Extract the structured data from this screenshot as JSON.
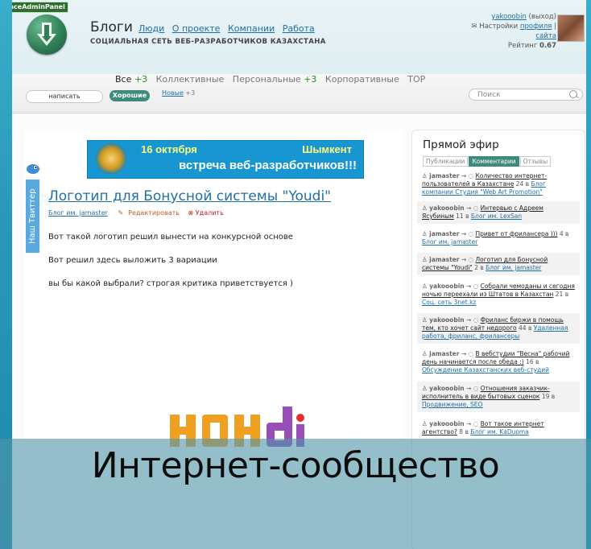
{
  "admin_badge": "PaceAdminPanel",
  "site": {
    "title": "Блоги",
    "nav": [
      "Люди",
      "О проекте",
      "Компании",
      "Работа"
    ],
    "subtitle": "СОЦИАЛЬНАЯ СЕТЬ ВЕБ-РАЗРАБОТЧИКОВ КАЗАХСТАНА"
  },
  "user": {
    "name": "yakooobin",
    "logout": "(выход)",
    "settings_label": "Настройки",
    "profile_link": "профиля",
    "separator": "|",
    "site_link": "сайта",
    "rating_label": "Рейтинг",
    "rating_value": "0.67"
  },
  "tabs": [
    {
      "label": "Все",
      "count": "+3",
      "active": true
    },
    {
      "label": "Коллективные",
      "count": "",
      "active": false
    },
    {
      "label": "Персональные",
      "count": "+3",
      "active": false
    },
    {
      "label": "Корпоративные",
      "count": "",
      "active": false
    },
    {
      "label": "TOP",
      "count": "",
      "active": false
    }
  ],
  "write_button": "написать",
  "good_filter": "Хорошие",
  "new_filter": {
    "label": "Новые",
    "count": "+3"
  },
  "search_placeholder": "Поиск",
  "banner": {
    "date": "16 октября",
    "city": "Шымкент",
    "text": "встреча веб-разработчиков!!!"
  },
  "post": {
    "title": "Логотип для Бонусной системы \"Youdi\"",
    "blog_link": "Блог им. jamaster",
    "edit_label": "Редактировать",
    "delete_label": "Удалить",
    "paragraphs": [
      "Вот такой логотип решил вынести на конкурсной основе",
      "Вот решил здесь выложить 3 вариации",
      "вы бы какой выбрали? строгая критика приветствуется )"
    ]
  },
  "twitter_tab": "Наш Твиттер",
  "sidebar": {
    "title": "Прямой эфир",
    "tabs": [
      "Публикации",
      "Комментарии",
      "Отзывы"
    ],
    "active_tab": "Комментарии",
    "feed": [
      {
        "user": "jamaster",
        "topic": "Количество интернет-пользователей в Казахстане",
        "count": "24",
        "in": "в",
        "blog": "Блог компании Студия \"Web Art Promotion\""
      },
      {
        "user": "yakooobin",
        "topic": "Интервью с Адреем Ясубиным",
        "count": "11",
        "in": "в",
        "blog": "Блог им. LexSan"
      },
      {
        "user": "jamaster",
        "topic": "Привет от фрилансера )))",
        "count": "4",
        "in": "в",
        "blog": "Блог им. jamaster"
      },
      {
        "user": "jamaster",
        "topic": "Логотип для Бонусной системы \"Youdi\"",
        "count": "2",
        "in": "в",
        "blog": "Блог им. jamaster"
      },
      {
        "user": "yakooobin",
        "topic": "Собрали чемоданы и сегодня ночью переехали из Штатов в Казахстан",
        "count": "21",
        "in": "в",
        "blog": "Соц. сеть 3net.kz"
      },
      {
        "user": "yakooobin",
        "topic": "Фриланс биржи в помощь тем, кто хочет сайт недорого",
        "count": "44",
        "in": "в",
        "blog": "Удаленная работа, фриланс, фрилансеры"
      },
      {
        "user": "jamaster",
        "topic": "В вебстудии \"Весна\" рабочий день начинается после обеда :)",
        "count": "16",
        "in": "в",
        "blog": "Обсуждение Казахстанских веб-студий"
      },
      {
        "user": "yakooobin",
        "topic": "Отношения заказчик-исполнитель в виде бытовых сценок",
        "count": "19",
        "in": "в",
        "blog": "Продвижение, SEO"
      },
      {
        "user": "yakooobin",
        "topic": "Вот такое интернет агентство?",
        "count": "8",
        "in": "в",
        "blog": "Блог им. KaDuoma"
      }
    ]
  },
  "overlay_caption": "Интернет-сообщество"
}
